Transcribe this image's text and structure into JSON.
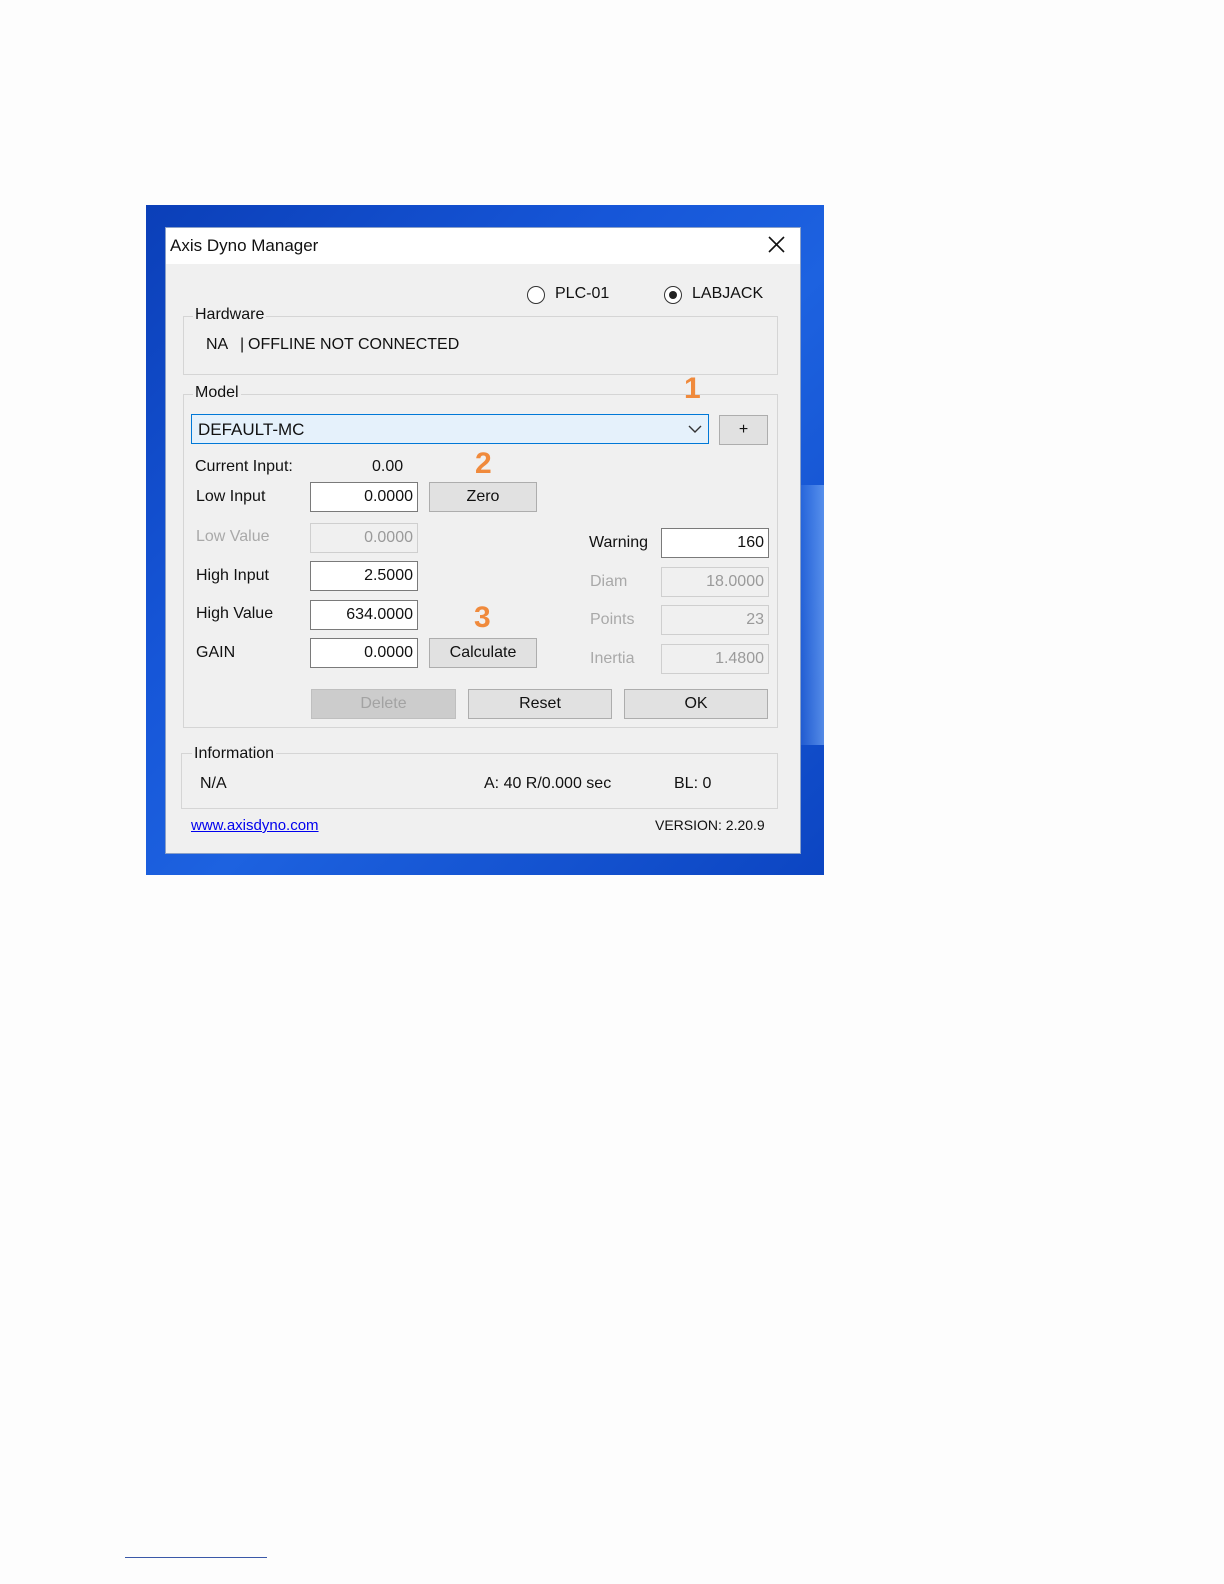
{
  "window": {
    "title": "Axis Dyno Manager"
  },
  "hardware_mode": {
    "options": [
      {
        "label": "PLC-01",
        "selected": false
      },
      {
        "label": "LABJACK",
        "selected": true
      }
    ]
  },
  "hardware": {
    "legend": "Hardware",
    "id": "NA",
    "separator": "|",
    "status": "OFFLINE NOT CONNECTED"
  },
  "model": {
    "legend": "Model",
    "selected": "DEFAULT-MC",
    "add_label": "+",
    "current_input_label": "Current Input:",
    "current_input_value": "0.00",
    "low_input_label": "Low Input",
    "low_input_value": "0.0000",
    "zero_label": "Zero",
    "low_value_label": "Low Value",
    "low_value_value": "0.0000",
    "high_input_label": "High Input",
    "high_input_value": "2.5000",
    "high_value_label": "High Value",
    "high_value_value": "634.0000",
    "gain_label": "GAIN",
    "gain_value": "0.0000",
    "calculate_label": "Calculate",
    "warning_label": "Warning",
    "warning_value": "160",
    "diam_label": "Diam",
    "diam_value": "18.0000",
    "points_label": "Points",
    "points_value": "23",
    "inertia_label": "Inertia",
    "inertia_value": "1.4800",
    "delete_label": "Delete",
    "reset_label": "Reset",
    "ok_label": "OK"
  },
  "annotations": {
    "marker_1": "1",
    "marker_2": "2",
    "marker_3": "3",
    "color": "#f08a3c"
  },
  "information": {
    "legend": "Information",
    "status": "N/A",
    "rate": "A: 40 R/0.000 sec",
    "bl": "BL: 0"
  },
  "footer": {
    "link": "www.axisdyno.com",
    "version": "VERSION: 2.20.9"
  },
  "icons": {
    "close": "close-icon",
    "dropdown": "chevron-down-icon"
  },
  "colors": {
    "desktop_blue": "#1656d8",
    "window_bg": "#f0f0f0",
    "combo_focus": "#0078d7"
  }
}
